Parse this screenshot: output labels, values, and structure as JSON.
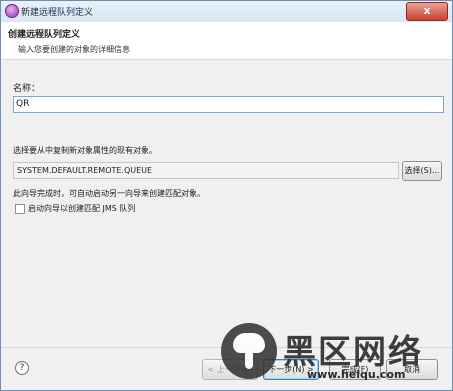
{
  "window": {
    "title": "新建远程队列定义",
    "close_label": "x"
  },
  "header": {
    "title": "创建远程队列定义",
    "description": "输入您要创建的对象的详细信息"
  },
  "form": {
    "name_label": "名称：",
    "name_value": "QR",
    "copy_label": "选择要从中复制新对象属性的现有对象。",
    "copy_value": "SYSTEM.DEFAULT.REMOTE.QUEUE",
    "select_button": "选择(S)...",
    "info_text": "此向导完成时，可自动启动另一向导来创建匹配对象。",
    "checkbox_label": "启动向导以创建匹配 JMS 队列",
    "checkbox_checked": false
  },
  "footer": {
    "help_icon": "question-mark",
    "back_label": "< 上一步(B)",
    "next_label": "下一步(N) >",
    "finish_label": "完成(F)",
    "cancel_label": "取消"
  },
  "watermark": {
    "text": "黑区网络",
    "url": "www.heiqu.com"
  }
}
